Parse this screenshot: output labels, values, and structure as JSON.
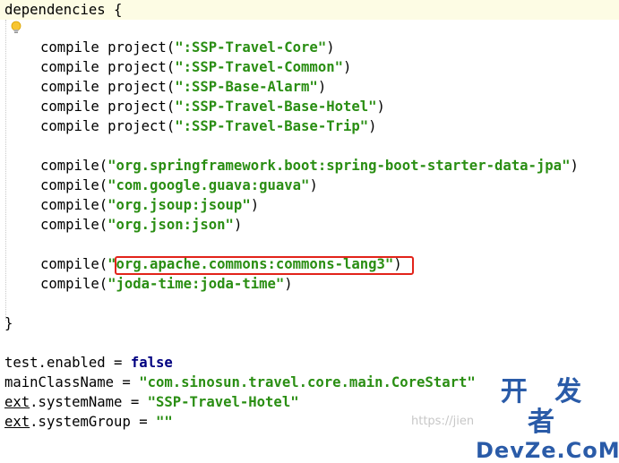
{
  "code": {
    "l1": "dependencies {",
    "l2_kw": "compile project(",
    "l2_s": "\":SSP-Travel-Core\"",
    "l2_e": ")",
    "l3_kw": "compile project(",
    "l3_s": "\":SSP-Travel-Common\"",
    "l3_e": ")",
    "l4_kw": "compile project(",
    "l4_s": "\":SSP-Base-Alarm\"",
    "l4_e": ")",
    "l5_kw": "compile project(",
    "l5_s": "\":SSP-Travel-Base-Hotel\"",
    "l5_e": ")",
    "l6_kw": "compile project(",
    "l6_s": "\":SSP-Travel-Base-Trip\"",
    "l6_e": ")",
    "l7_kw": "compile(",
    "l7_s": "\"org.springframework.boot:spring-boot-starter-data-jpa\"",
    "l7_e": ")",
    "l8_kw": "compile(",
    "l8_s": "\"com.google.guava:guava\"",
    "l8_e": ")",
    "l9_kw": "compile(",
    "l9_s": "\"org.jsoup:jsoup\"",
    "l9_e": ")",
    "l10_kw": "compile(",
    "l10_s": "\"org.json:json\"",
    "l10_e": ")",
    "l11_kw": "compile(",
    "l11_s": "\"org.apache.commons:commons-lang3\"",
    "l11_e": ")",
    "l12_kw": "compile(",
    "l12_s": "\"joda-time:joda-time\"",
    "l12_e": ")",
    "l13": "}",
    "l14_a": "test.enabled = ",
    "l14_b": "false",
    "l15_a": "mainClassName = ",
    "l15_s": "\"com.sinosun.travel.core.main.CoreStart\"",
    "l16_u": "ext",
    "l16_a": ".systemName = ",
    "l16_s": "\"SSP-Travel-Hotel\"",
    "l17_u": "ext",
    "l17_a": ".systemGroup = ",
    "l17_s": "\"\""
  },
  "watermark": {
    "url": "https://jien",
    "logo_cn": "开 发 者",
    "logo_en": "DevZe.CoM"
  },
  "colors": {
    "string": "#2a8e13",
    "highlight": "#e2231a",
    "current_line": "#fdfce4"
  },
  "icons": {
    "intention": "lightbulb-icon"
  }
}
